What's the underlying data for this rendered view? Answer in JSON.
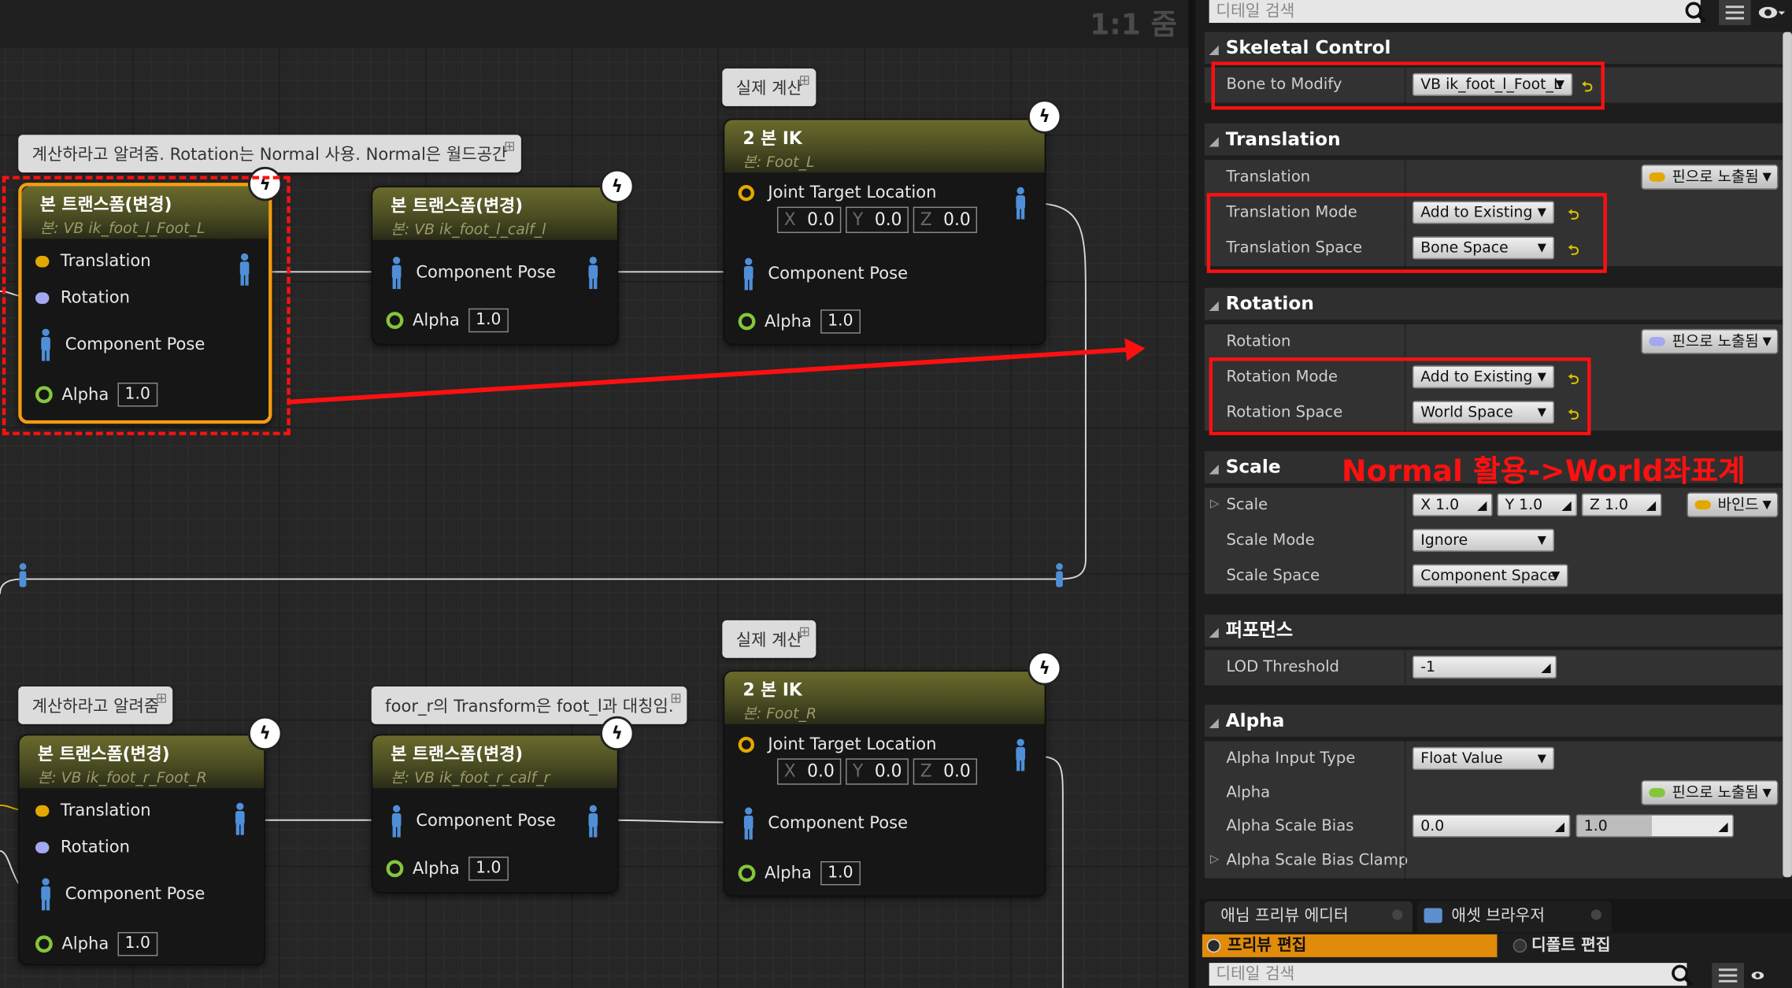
{
  "graph": {
    "zoom_label": "1:1 줌",
    "comments": [
      "계산하라고 알려줌. Rotation는 Normal 사용. Normal은 월드공간",
      "실제 계산",
      "계산하라고 알려줌",
      "foor_r의 Transform은 foot_l과 대칭임.",
      "실제 계산"
    ],
    "nodes": {
      "n1": {
        "title": "본 트랜스폼(변경)",
        "subtitle": "본: VB ik_foot_l_Foot_L",
        "pin_translation": "Translation",
        "pin_rotation": "Rotation",
        "pin_pose": "Component Pose",
        "pin_alpha": "Alpha",
        "alpha": "1.0"
      },
      "n2": {
        "title": "본 트랜스폼(변경)",
        "subtitle": "본: VB ik_foot_l_calf_l",
        "pin_pose": "Component Pose",
        "pin_alpha": "Alpha",
        "alpha": "1.0"
      },
      "n3": {
        "title": "2 본 IK",
        "subtitle": "본: Foot_L",
        "pin_joint": "Joint Target Location",
        "x_label": "X",
        "x": "0.0",
        "y_label": "Y",
        "y": "0.0",
        "z_label": "Z",
        "z": "0.0",
        "pin_pose": "Component Pose",
        "pin_alpha": "Alpha",
        "alpha": "1.0"
      },
      "n4": {
        "title": "본 트랜스폼(변경)",
        "subtitle": "본: VB ik_foot_r_Foot_R",
        "pin_translation": "Translation",
        "pin_rotation": "Rotation",
        "pin_pose": "Component Pose",
        "pin_alpha": "Alpha",
        "alpha": "1.0"
      },
      "n5": {
        "title": "본 트랜스폼(변경)",
        "subtitle": "본: VB ik_foot_r_calf_r",
        "pin_pose": "Component Pose",
        "pin_alpha": "Alpha",
        "alpha": "1.0"
      },
      "n6": {
        "title": "2 본 IK",
        "subtitle": "본: Foot_R",
        "pin_joint": "Joint Target Location",
        "x_label": "X",
        "x": "0.0",
        "y_label": "Y",
        "y": "0.0",
        "z_label": "Z",
        "z": "0.0",
        "pin_pose": "Component Pose",
        "pin_alpha": "Alpha",
        "alpha": "1.0"
      }
    }
  },
  "details": {
    "search_placeholder": "디테일 검색",
    "sections": {
      "skeletal": "Skeletal Control",
      "translation": "Translation",
      "rotation": "Rotation",
      "scale": "Scale",
      "performance": "퍼포먼스",
      "alpha": "Alpha"
    },
    "rows": {
      "bone_to_modify": {
        "label": "Bone to Modify",
        "value": "VB ik_foot_l_Foot_L"
      },
      "translation": {
        "label": "Translation",
        "value": "핀으로 노출됨"
      },
      "translation_mode": {
        "label": "Translation Mode",
        "value": "Add to Existing"
      },
      "translation_space": {
        "label": "Translation Space",
        "value": "Bone Space"
      },
      "rotation": {
        "label": "Rotation",
        "value": "핀으로 노출됨"
      },
      "rotation_mode": {
        "label": "Rotation Mode",
        "value": "Add to Existing"
      },
      "rotation_space": {
        "label": "Rotation Space",
        "value": "World Space"
      },
      "scale": {
        "label": "Scale",
        "x": "X  1.0",
        "y": "Y  1.0",
        "z": "Z  1.0",
        "value": "바인드"
      },
      "scale_mode": {
        "label": "Scale Mode",
        "value": "Ignore"
      },
      "scale_space": {
        "label": "Scale Space",
        "value": "Component Space"
      },
      "lod_threshold": {
        "label": "LOD Threshold",
        "value": "-1"
      },
      "alpha_input_type": {
        "label": "Alpha Input Type",
        "value": "Float Value"
      },
      "alpha": {
        "label": "Alpha",
        "value": "핀으로 노출됨"
      },
      "alpha_scale_bias": {
        "label": "Alpha Scale Bias",
        "min": "0.0",
        "max": "1.0"
      },
      "alpha_scale_bias_clamp": {
        "label": "Alpha Scale Bias Clamp"
      }
    },
    "annotation": "Normal 활용->World좌표계"
  },
  "bottom": {
    "tab_preview": "애님 프리뷰 에디터",
    "tab_assets": "애셋 브라우저",
    "btn_preview_edit": "프리뷰 편집",
    "btn_default_edit": "디폴트 편집",
    "search_placeholder": "디테일 검색"
  },
  "colors": {
    "annotation_red": "#ff1010",
    "node_selected": "#f39c12",
    "pin_translation": "#e3a800",
    "pin_rotation": "#a3a8f0",
    "pin_alpha": "#84c63a",
    "pin_pose": "#4f8fd8"
  }
}
